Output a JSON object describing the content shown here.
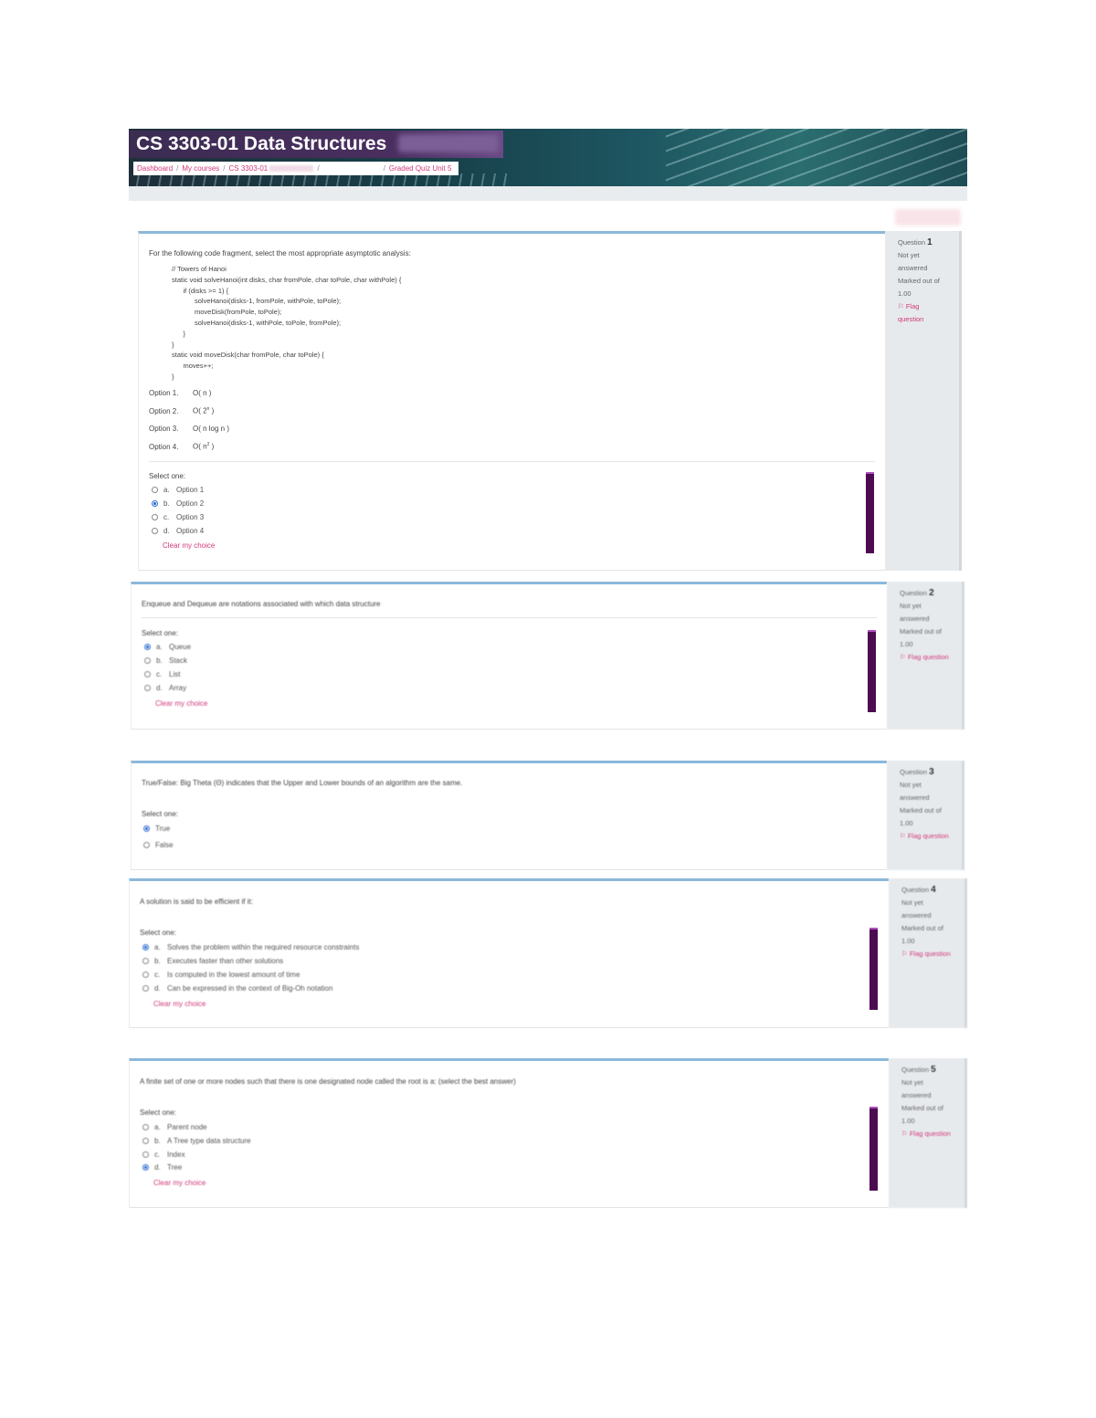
{
  "header": {
    "course_title": "CS 3303-01 Data Structures",
    "breadcrumb": {
      "dashboard": "Dashboard",
      "sep": "/",
      "my_courses": "My courses",
      "course": "CS 3303-01",
      "quiz": "Graded Quiz Unit 5"
    }
  },
  "questions": [
    {
      "info": {
        "label": "Question",
        "number": "1",
        "status": "Not yet answered",
        "marked": "Marked out of 1.00",
        "flag": "Flag question"
      },
      "prompt": "For the following code fragment, select the most appropriate asymptotic analysis:",
      "code": [
        "// Towers of Hanoi",
        "static void solveHanoi(int disks, char fromPole, char toPole, char withPole) {",
        "      if (disks >= 1) {",
        "            solveHanoi(disks-1, fromPole, withPole, toPole);",
        "            moveDisk(fromPole, toPole);",
        "            solveHanoi(disks-1, withPole, toPole, fromPole);",
        "      }",
        "}",
        "static void moveDisk(char fromPole, char toPole) {",
        "      moves++;",
        "}"
      ],
      "choices_text": [
        {
          "label": "Option 1.",
          "value": "O( n )"
        },
        {
          "label": "Option 2.",
          "value": "O( 2",
          "sup": "n",
          "tail": " )"
        },
        {
          "label": "Option 3.",
          "value": "O( n log n )"
        },
        {
          "label": "Option 4.",
          "value": "O( n",
          "sup": "2",
          "tail": " )"
        }
      ],
      "select_one": "Select one:",
      "options": [
        {
          "letter": "a.",
          "text": "Option 1"
        },
        {
          "letter": "b.",
          "text": "Option 2"
        },
        {
          "letter": "c.",
          "text": "Option 3"
        },
        {
          "letter": "d.",
          "text": "Option 4"
        }
      ],
      "selected": "b",
      "clear": "Clear my choice"
    },
    {
      "info": {
        "label": "Question",
        "number": "2",
        "status": "Not yet answered",
        "marked": "Marked out of 1.00",
        "flag": "Flag question"
      },
      "prompt": "Enqueue and Dequeue are notations associated with which data structure",
      "select_one": "Select one:",
      "options": [
        {
          "letter": "a.",
          "text": "Queue"
        },
        {
          "letter": "b.",
          "text": "Stack"
        },
        {
          "letter": "c.",
          "text": "List"
        },
        {
          "letter": "d.",
          "text": "Array"
        }
      ],
      "selected": "a",
      "clear": "Clear my choice"
    },
    {
      "info": {
        "label": "Question",
        "number": "3",
        "status": "Not yet answered",
        "marked": "Marked out of 1.00",
        "flag": "Flag question"
      },
      "prompt": "True/False: Big Theta (Θ) indicates that the Upper and Lower bounds of an algorithm are the same.",
      "select_one": "Select one:",
      "options": [
        {
          "letter": "",
          "text": "True"
        },
        {
          "letter": "",
          "text": "False"
        }
      ],
      "selected": "True"
    },
    {
      "info": {
        "label": "Question",
        "number": "4",
        "status": "Not yet answered",
        "marked": "Marked out of 1.00",
        "flag": "Flag question"
      },
      "prompt": "A solution is said to be efficient if it:",
      "select_one": "Select one:",
      "options": [
        {
          "letter": "a.",
          "text": "Solves the problem within the required resource constraints"
        },
        {
          "letter": "b.",
          "text": "Executes faster than other solutions"
        },
        {
          "letter": "c.",
          "text": "Is computed in the lowest amount of time"
        },
        {
          "letter": "d.",
          "text": "Can be expressed in the context of Big-Oh notation"
        }
      ],
      "selected": "a",
      "clear": "Clear my choice"
    },
    {
      "info": {
        "label": "Question",
        "number": "5",
        "status": "Not yet answered",
        "marked": "Marked out of 1.00",
        "flag": "Flag question"
      },
      "prompt": "A finite set of one or more nodes such that there is one designated node called the root is a: (select the best answer)",
      "select_one": "Select one:",
      "options": [
        {
          "letter": "a.",
          "text": "Parent node"
        },
        {
          "letter": "b.",
          "text": "A Tree type data structure"
        },
        {
          "letter": "c.",
          "text": "Index"
        },
        {
          "letter": "d.",
          "text": "Tree"
        }
      ],
      "selected": "d",
      "clear": "Clear my choice"
    }
  ]
}
